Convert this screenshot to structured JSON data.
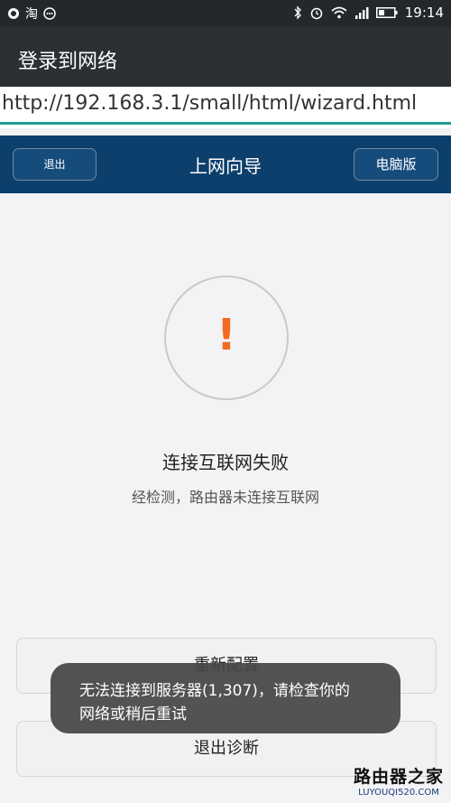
{
  "status_bar": {
    "icons_left": [
      "tencent-icon",
      "taobao-icon",
      "chat-icon"
    ],
    "left_char": "淘",
    "time": "19:14"
  },
  "appbar": {
    "title": "登录到网络"
  },
  "url_bar": {
    "url": "http://192.168.3.1/small/html/wizard.html"
  },
  "header": {
    "title": "上网向导",
    "exit_label": "退出",
    "pc_label": "电脑版"
  },
  "content": {
    "icon": "exclamation-icon",
    "icon_glyph": "!",
    "fail_title": "连接互联网失败",
    "fail_desc": "经检测，路由器未连接互联网"
  },
  "buttons": {
    "reconfigure": "重新配置",
    "exit_diagnosis": "退出诊断"
  },
  "toast": {
    "line1": "无法连接到服务器(1,307)，请检查你的",
    "line2": "网络或稍后重试"
  },
  "watermark": {
    "brand": "路由器之家",
    "site": "LUYOUQI520.COM"
  },
  "colors": {
    "header_bg": "#0c3f6b",
    "accent_orange": "#f26b21",
    "status_bg": "#23282c",
    "url_line": "#1b9e8f"
  }
}
